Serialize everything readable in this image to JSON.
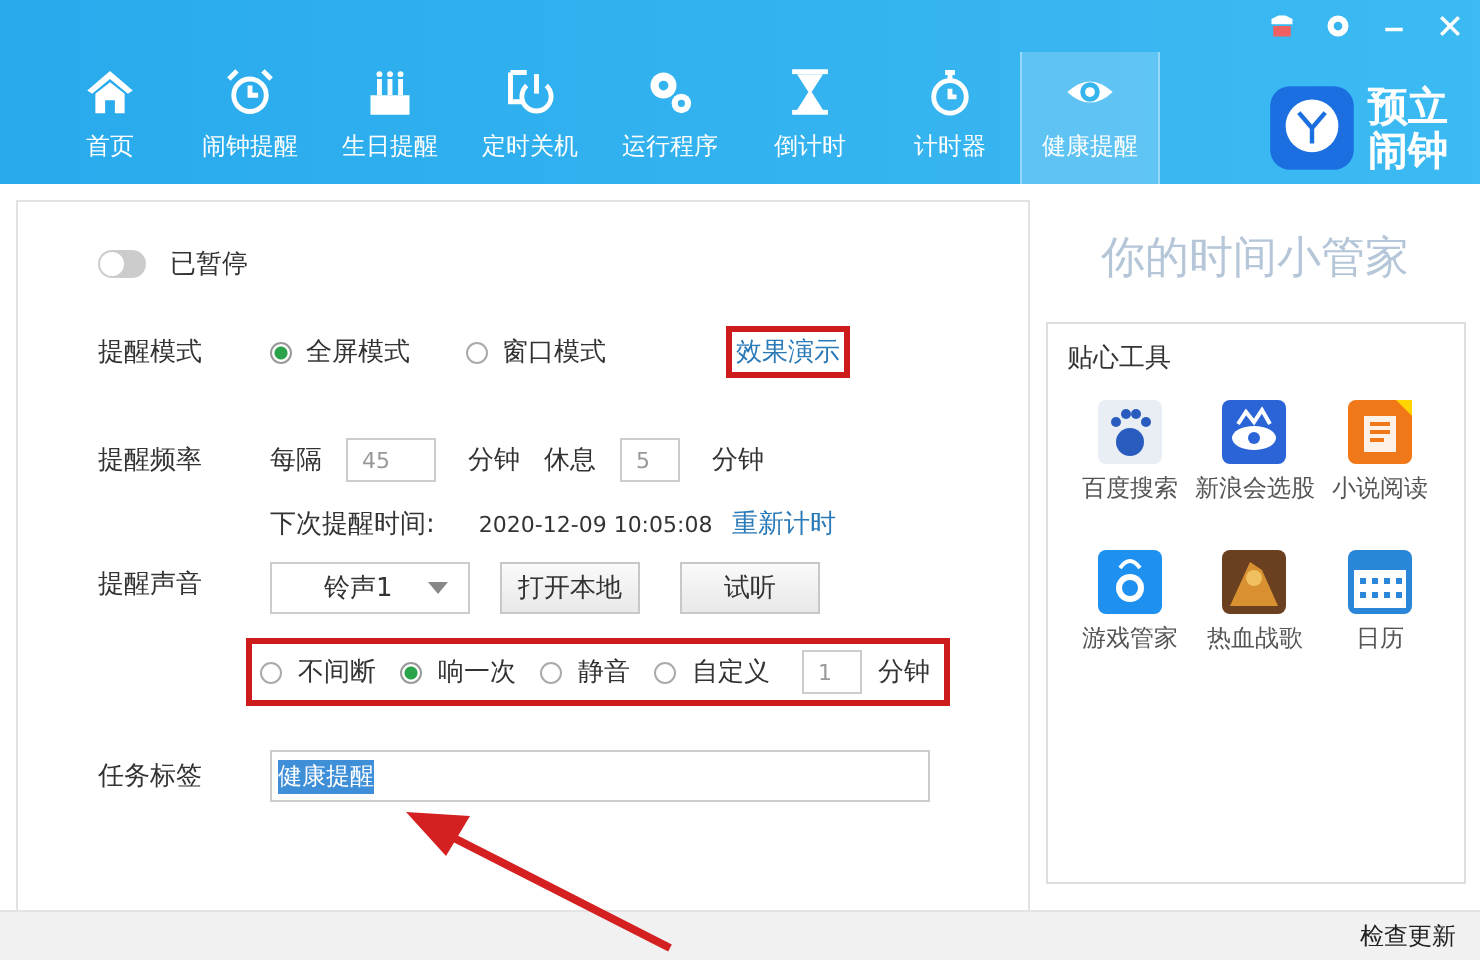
{
  "nav": [
    {
      "label": "首页",
      "selected": false
    },
    {
      "label": "闹钟提醒",
      "selected": false
    },
    {
      "label": "生日提醒",
      "selected": false
    },
    {
      "label": "定时关机",
      "selected": false
    },
    {
      "label": "运行程序",
      "selected": false
    },
    {
      "label": "倒计时",
      "selected": false
    },
    {
      "label": "计时器",
      "selected": false
    },
    {
      "label": "健康提醒",
      "selected": true
    }
  ],
  "logo": {
    "line_1": "预立",
    "line_2": "闹钟"
  },
  "pause_toggle": {
    "on": false,
    "label": "已暂停"
  },
  "mode": {
    "label": "提醒模式",
    "options": [
      {
        "label": "全屏模式",
        "selected": true
      },
      {
        "label": "窗口模式",
        "selected": false
      }
    ],
    "demo_link": "效果演示"
  },
  "frequency": {
    "label": "提醒频率",
    "every": "每隔",
    "interval": "45",
    "interval_unit": "分钟",
    "rest": "休息",
    "rest_value": "5",
    "rest_unit": "分钟"
  },
  "next": {
    "label": "下次提醒时间:",
    "time": "2020-12-09 10:05:08",
    "reset_link": "重新计时"
  },
  "sound": {
    "label": "提醒声音",
    "ringtone": "铃声1",
    "buttons": [
      "打开本地",
      "试听"
    ],
    "play_options": [
      {
        "label": "不间断",
        "selected": false
      },
      {
        "label": "响一次",
        "selected": true
      },
      {
        "label": "静音",
        "selected": false
      },
      {
        "label": "自定义",
        "selected": false
      }
    ],
    "custom_value": "1",
    "custom_unit": "分钟"
  },
  "task_tag": {
    "label": "任务标签",
    "value": "健康提醒"
  },
  "slogan": "你的时间小管家",
  "tools": {
    "title": "贴心工具",
    "items": [
      {
        "label": "百度搜索"
      },
      {
        "label": "新浪会选股"
      },
      {
        "label": "小说阅读"
      },
      {
        "label": "游戏管家"
      },
      {
        "label": "热血战歌"
      },
      {
        "label": "日历"
      }
    ]
  },
  "status_bar": {
    "update_link": "检查更新"
  }
}
